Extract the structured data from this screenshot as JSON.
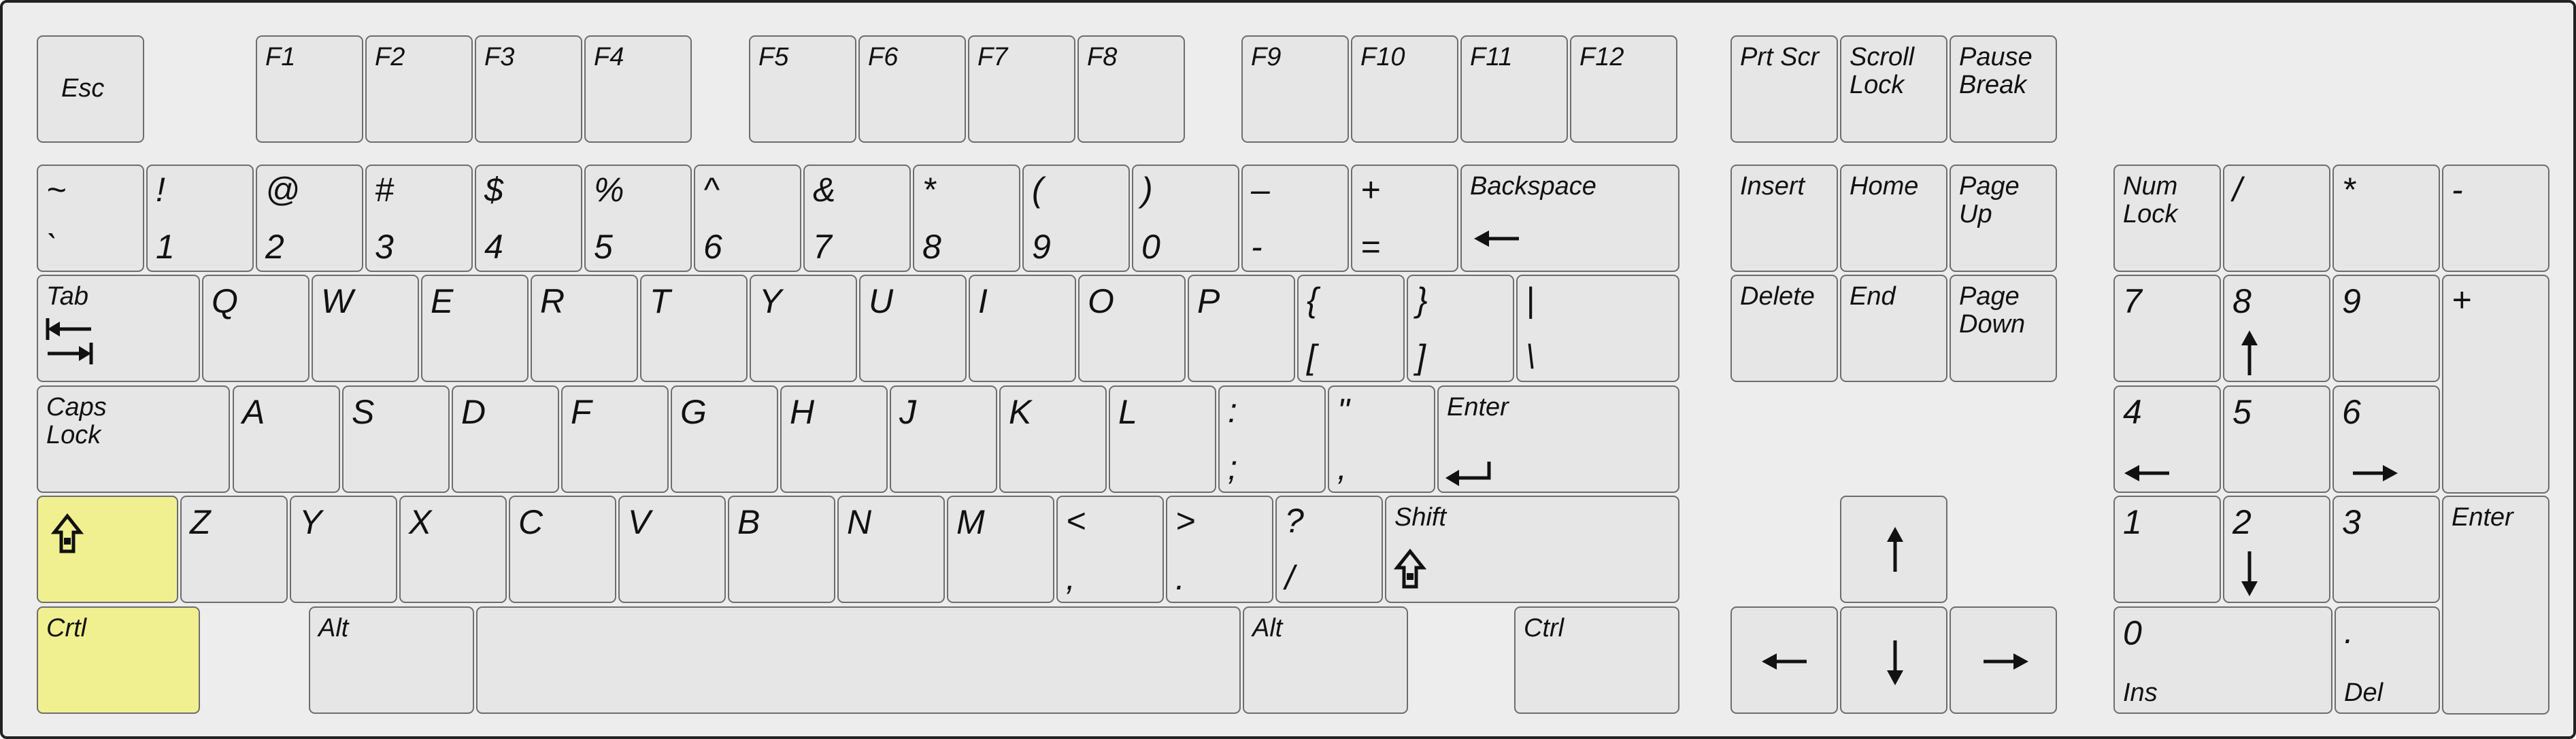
{
  "colors": {
    "board": "#ededed",
    "key": "#e6e6e6",
    "key_border": "#6d6d6d",
    "highlight": "#f1f091",
    "frame": "#222222"
  },
  "keys": [
    {
      "id": "esc",
      "labels": [
        {
          "t": "Esc",
          "p": "mid"
        }
      ]
    },
    {
      "id": "f1",
      "labels": [
        {
          "t": "F1",
          "p": "tl"
        }
      ]
    },
    {
      "id": "f2",
      "labels": [
        {
          "t": "F2",
          "p": "tl"
        }
      ]
    },
    {
      "id": "f3",
      "labels": [
        {
          "t": "F3",
          "p": "tl"
        }
      ]
    },
    {
      "id": "f4",
      "labels": [
        {
          "t": "F4",
          "p": "tl"
        }
      ]
    },
    {
      "id": "f5",
      "labels": [
        {
          "t": "F5",
          "p": "tl"
        }
      ]
    },
    {
      "id": "f6",
      "labels": [
        {
          "t": "F6",
          "p": "tl"
        }
      ]
    },
    {
      "id": "f7",
      "labels": [
        {
          "t": "F7",
          "p": "tl"
        }
      ]
    },
    {
      "id": "f8",
      "labels": [
        {
          "t": "F8",
          "p": "tl"
        }
      ]
    },
    {
      "id": "f9",
      "labels": [
        {
          "t": "F9",
          "p": "tl"
        }
      ]
    },
    {
      "id": "f10",
      "labels": [
        {
          "t": "F10",
          "p": "tl"
        }
      ]
    },
    {
      "id": "f11",
      "labels": [
        {
          "t": "F11",
          "p": "tl"
        }
      ]
    },
    {
      "id": "f12",
      "labels": [
        {
          "t": "F12",
          "p": "tl"
        }
      ]
    },
    {
      "id": "prtscr",
      "labels": [
        {
          "t": "Prt Scr",
          "p": "tl"
        }
      ]
    },
    {
      "id": "scrolllock",
      "labels": [
        {
          "t": "Scroll\nLock",
          "p": "tl"
        }
      ]
    },
    {
      "id": "pausebreak",
      "labels": [
        {
          "t": "Pause\nBreak",
          "p": "tl"
        }
      ]
    },
    {
      "id": "tilde",
      "labels": [
        {
          "t": "~",
          "p": "tl"
        },
        {
          "t": "`",
          "p": "bl"
        }
      ]
    },
    {
      "id": "1",
      "labels": [
        {
          "t": "!",
          "p": "tl"
        },
        {
          "t": "1",
          "p": "bl"
        }
      ]
    },
    {
      "id": "2",
      "labels": [
        {
          "t": "@",
          "p": "tl"
        },
        {
          "t": "2",
          "p": "bl"
        }
      ]
    },
    {
      "id": "3",
      "labels": [
        {
          "t": "#",
          "p": "tl"
        },
        {
          "t": "3",
          "p": "bl"
        }
      ]
    },
    {
      "id": "4",
      "labels": [
        {
          "t": "$",
          "p": "tl"
        },
        {
          "t": "4",
          "p": "bl"
        }
      ]
    },
    {
      "id": "5",
      "labels": [
        {
          "t": "%",
          "p": "tl"
        },
        {
          "t": "5",
          "p": "bl"
        }
      ]
    },
    {
      "id": "6",
      "labels": [
        {
          "t": "^",
          "p": "tl"
        },
        {
          "t": "6",
          "p": "bl"
        }
      ]
    },
    {
      "id": "7",
      "labels": [
        {
          "t": "&",
          "p": "tl"
        },
        {
          "t": "7",
          "p": "bl"
        }
      ]
    },
    {
      "id": "8",
      "labels": [
        {
          "t": "*",
          "p": "tl"
        },
        {
          "t": "8",
          "p": "bl"
        }
      ]
    },
    {
      "id": "9",
      "labels": [
        {
          "t": "(",
          "p": "tl"
        },
        {
          "t": "9",
          "p": "bl"
        }
      ]
    },
    {
      "id": "0",
      "labels": [
        {
          "t": ")",
          "p": "tl"
        },
        {
          "t": "0",
          "p": "bl"
        }
      ]
    },
    {
      "id": "minus",
      "labels": [
        {
          "t": "–",
          "p": "tl"
        },
        {
          "t": "-",
          "p": "bl"
        }
      ]
    },
    {
      "id": "equals",
      "labels": [
        {
          "t": "+",
          "p": "tl"
        },
        {
          "t": "=",
          "p": "bl"
        }
      ]
    },
    {
      "id": "backspace",
      "labels": [
        {
          "t": "Backspace",
          "p": "tl"
        }
      ],
      "icon": "arrow-left"
    },
    {
      "id": "insert",
      "labels": [
        {
          "t": "Insert",
          "p": "tl"
        }
      ]
    },
    {
      "id": "home",
      "labels": [
        {
          "t": "Home",
          "p": "tl"
        }
      ]
    },
    {
      "id": "pageup",
      "labels": [
        {
          "t": "Page\nUp",
          "p": "tl"
        }
      ]
    },
    {
      "id": "numlock",
      "labels": [
        {
          "t": "Num\nLock",
          "p": "tl"
        }
      ]
    },
    {
      "id": "numslash",
      "labels": [
        {
          "t": "/",
          "p": "tl"
        }
      ]
    },
    {
      "id": "numstar",
      "labels": [
        {
          "t": "*",
          "p": "tl"
        }
      ]
    },
    {
      "id": "numminus",
      "labels": [
        {
          "t": "-",
          "p": "tl"
        }
      ]
    },
    {
      "id": "tab",
      "labels": [
        {
          "t": "Tab",
          "p": "tl"
        }
      ],
      "icon": "tab"
    },
    {
      "id": "q",
      "labels": [
        {
          "t": "Q",
          "p": "tl"
        }
      ]
    },
    {
      "id": "w",
      "labels": [
        {
          "t": "W",
          "p": "tl"
        }
      ]
    },
    {
      "id": "e",
      "labels": [
        {
          "t": "E",
          "p": "tl"
        }
      ]
    },
    {
      "id": "r",
      "labels": [
        {
          "t": "R",
          "p": "tl"
        }
      ]
    },
    {
      "id": "t",
      "labels": [
        {
          "t": "T",
          "p": "tl"
        }
      ]
    },
    {
      "id": "y",
      "labels": [
        {
          "t": "Y",
          "p": "tl"
        }
      ]
    },
    {
      "id": "u",
      "labels": [
        {
          "t": "U",
          "p": "tl"
        }
      ]
    },
    {
      "id": "i",
      "labels": [
        {
          "t": "I",
          "p": "tl"
        }
      ]
    },
    {
      "id": "o",
      "labels": [
        {
          "t": "O",
          "p": "tl"
        }
      ]
    },
    {
      "id": "p",
      "labels": [
        {
          "t": "P",
          "p": "tl"
        }
      ]
    },
    {
      "id": "lbracket",
      "labels": [
        {
          "t": "{",
          "p": "tl"
        },
        {
          "t": "[",
          "p": "bl"
        }
      ]
    },
    {
      "id": "rbracket",
      "labels": [
        {
          "t": "}",
          "p": "tl"
        },
        {
          "t": "]",
          "p": "bl"
        }
      ]
    },
    {
      "id": "backslash",
      "labels": [
        {
          "t": "|",
          "p": "tl"
        },
        {
          "t": "\\",
          "p": "bl"
        }
      ]
    },
    {
      "id": "delete",
      "labels": [
        {
          "t": "Delete",
          "p": "tl"
        }
      ]
    },
    {
      "id": "end",
      "labels": [
        {
          "t": "End",
          "p": "tl"
        }
      ]
    },
    {
      "id": "pagedown",
      "labels": [
        {
          "t": "Page\nDown",
          "p": "tl"
        }
      ]
    },
    {
      "id": "num7",
      "labels": [
        {
          "t": "7",
          "p": "tl"
        }
      ]
    },
    {
      "id": "num8",
      "labels": [
        {
          "t": "8",
          "p": "tl"
        }
      ],
      "icon": "arrow-up"
    },
    {
      "id": "num9",
      "labels": [
        {
          "t": "9",
          "p": "tl"
        }
      ]
    },
    {
      "id": "numplus",
      "labels": [
        {
          "t": "+",
          "p": "tl"
        }
      ]
    },
    {
      "id": "capslock",
      "labels": [
        {
          "t": "Caps\nLock",
          "p": "tl"
        }
      ]
    },
    {
      "id": "a",
      "labels": [
        {
          "t": "A",
          "p": "tl"
        }
      ]
    },
    {
      "id": "s",
      "labels": [
        {
          "t": "S",
          "p": "tl"
        }
      ]
    },
    {
      "id": "d",
      "labels": [
        {
          "t": "D",
          "p": "tl"
        }
      ]
    },
    {
      "id": "f",
      "labels": [
        {
          "t": "F",
          "p": "tl"
        }
      ]
    },
    {
      "id": "g",
      "labels": [
        {
          "t": "G",
          "p": "tl"
        }
      ]
    },
    {
      "id": "h",
      "labels": [
        {
          "t": "H",
          "p": "tl"
        }
      ]
    },
    {
      "id": "j",
      "labels": [
        {
          "t": "J",
          "p": "tl"
        }
      ]
    },
    {
      "id": "k",
      "labels": [
        {
          "t": "K",
          "p": "tl"
        }
      ]
    },
    {
      "id": "l",
      "labels": [
        {
          "t": "L",
          "p": "tl"
        }
      ]
    },
    {
      "id": "semicolon",
      "labels": [
        {
          "t": ":",
          "p": "tl"
        },
        {
          "t": ";",
          "p": "bl"
        }
      ]
    },
    {
      "id": "quote",
      "labels": [
        {
          "t": "\"",
          "p": "tl"
        },
        {
          "t": ",",
          "p": "bl"
        }
      ]
    },
    {
      "id": "enter",
      "labels": [
        {
          "t": "Enter",
          "p": "tl"
        }
      ],
      "icon": "enter"
    },
    {
      "id": "num4",
      "labels": [
        {
          "t": "4",
          "p": "tl"
        }
      ],
      "icon": "arrow-left"
    },
    {
      "id": "num5",
      "labels": [
        {
          "t": "5",
          "p": "tl"
        }
      ]
    },
    {
      "id": "num6",
      "labels": [
        {
          "t": "6",
          "p": "tl"
        }
      ],
      "icon": "arrow-right"
    },
    {
      "id": "lshift",
      "labels": [],
      "icon": "shift",
      "highlight": true
    },
    {
      "id": "z",
      "labels": [
        {
          "t": "Z",
          "p": "tl"
        }
      ]
    },
    {
      "id": "x",
      "labels": [
        {
          "t": "Y",
          "p": "tl"
        }
      ]
    },
    {
      "id": "c",
      "labels": [
        {
          "t": "X",
          "p": "tl"
        }
      ]
    },
    {
      "id": "v",
      "labels": [
        {
          "t": "C",
          "p": "tl"
        }
      ]
    },
    {
      "id": "b",
      "labels": [
        {
          "t": "V",
          "p": "tl"
        }
      ]
    },
    {
      "id": "n",
      "labels": [
        {
          "t": "B",
          "p": "tl"
        }
      ]
    },
    {
      "id": "m",
      "labels": [
        {
          "t": "N",
          "p": "tl"
        }
      ]
    },
    {
      "id": "mm",
      "labels": [
        {
          "t": "M",
          "p": "tl"
        }
      ]
    },
    {
      "id": "comma",
      "labels": [
        {
          "t": "<",
          "p": "tl"
        },
        {
          "t": ",",
          "p": "bl"
        }
      ]
    },
    {
      "id": "period",
      "labels": [
        {
          "t": ">",
          "p": "tl"
        },
        {
          "t": ".",
          "p": "bl"
        }
      ]
    },
    {
      "id": "slash",
      "labels": [
        {
          "t": "?",
          "p": "tl"
        },
        {
          "t": "/",
          "p": "bl"
        }
      ]
    },
    {
      "id": "rshift",
      "labels": [
        {
          "t": "Shift",
          "p": "tl"
        }
      ],
      "icon": "shift"
    },
    {
      "id": "up",
      "labels": [],
      "icon": "arrow-up"
    },
    {
      "id": "num1",
      "labels": [
        {
          "t": "1",
          "p": "tl"
        }
      ]
    },
    {
      "id": "num2",
      "labels": [
        {
          "t": "2",
          "p": "tl"
        }
      ],
      "icon": "arrow-down"
    },
    {
      "id": "num3",
      "labels": [
        {
          "t": "3",
          "p": "tl"
        }
      ]
    },
    {
      "id": "numenter",
      "labels": [
        {
          "t": "Enter",
          "p": "tl"
        }
      ]
    },
    {
      "id": "lctrl",
      "labels": [
        {
          "t": "Crtl",
          "p": "tl"
        }
      ],
      "highlight": true
    },
    {
      "id": "lalt",
      "labels": [
        {
          "t": "Alt",
          "p": "tl"
        }
      ]
    },
    {
      "id": "space",
      "labels": []
    },
    {
      "id": "ralt",
      "labels": [
        {
          "t": "Alt",
          "p": "tl"
        }
      ]
    },
    {
      "id": "rctrl",
      "labels": [
        {
          "t": "Ctrl",
          "p": "tl"
        }
      ]
    },
    {
      "id": "left",
      "labels": [],
      "icon": "arrow-left"
    },
    {
      "id": "down",
      "labels": [],
      "icon": "arrow-down"
    },
    {
      "id": "right",
      "labels": [],
      "icon": "arrow-right"
    },
    {
      "id": "num0",
      "labels": [
        {
          "t": "0",
          "p": "tl"
        },
        {
          "t": "Ins",
          "p": "bl"
        }
      ]
    },
    {
      "id": "numdot",
      "labels": [
        {
          "t": ".",
          "p": "tl"
        },
        {
          "t": "Del",
          "p": "bl"
        }
      ]
    }
  ]
}
